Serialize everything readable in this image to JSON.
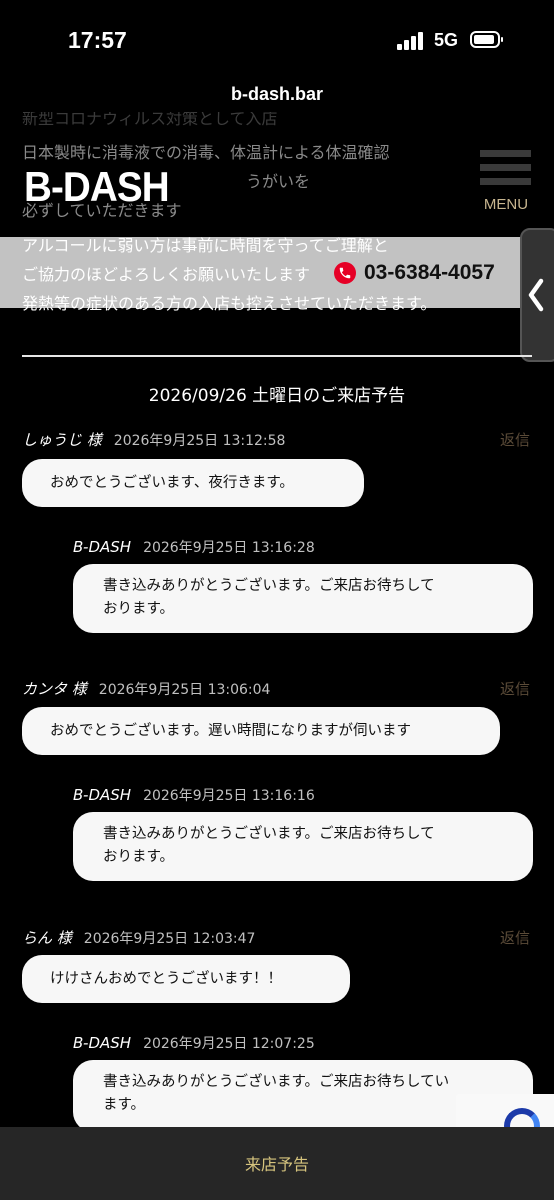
{
  "status_bar": {
    "time": "17:57",
    "network": "5G"
  },
  "browser": {
    "url": "b-dash.bar"
  },
  "notice_lines": [
    "新型コロナウィルス対策として入店",
    "日本製時に消毒液での消毒、体温計による体温確認",
    "うがいを",
    "必ずしていただきます",
    "アルコールに弱い方は事前に時間を守ってご理解と",
    "ご協力のほどよろしくお願いいたします",
    "発熱等の症状のある方の入店も控えさせていただきます。"
  ],
  "header": {
    "logo": "B-DASH",
    "menu_label": "MENU",
    "phone": "03-6384-4057"
  },
  "page_title": "2026/09/26 土曜日のご来店予告",
  "reply_label": "返信",
  "posts": [
    {
      "name": "しゅうじ 様",
      "time": "2026年9月25日 13:12:58",
      "message": "おめでとうございます、夜行きます。",
      "response": {
        "name": "B-DASH",
        "time": "2026年9月25日 13:16:28",
        "line1": "書き込みありがとうございます。ご来店お待ちして",
        "line2": "おります。"
      }
    },
    {
      "name": "カンタ 様",
      "time": "2026年9月25日 13:06:04",
      "message": "おめでとうございます。遅い時間になりますが伺います",
      "response": {
        "name": "B-DASH",
        "time": "2026年9月25日 13:16:16",
        "line1": "書き込みありがとうございます。ご来店お待ちして",
        "line2": "おります。"
      }
    },
    {
      "name": "らん 様",
      "time": "2026年9月25日 12:03:47",
      "message": "けけさんおめでとうございます！！",
      "response": {
        "name": "B-DASH",
        "time": "2026年9月25日 12:07:25",
        "line1": "書き込みありがとうございます。ご来店お待ちしてい",
        "line2": "ます。"
      }
    }
  ],
  "bottom_nav": {
    "label": "来店予告"
  },
  "colors": {
    "background": "#000000",
    "accent_gold": "#d6c47e",
    "reply_brown": "#5b4b38",
    "phone_red": "#e60026",
    "bubble": "#f7f7f7"
  }
}
